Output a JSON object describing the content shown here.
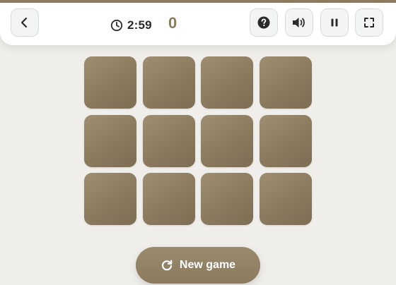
{
  "header": {
    "back_icon": "chevron-left-icon",
    "timer": {
      "icon": "clock-icon",
      "text": "2:59"
    },
    "score": "0",
    "buttons": [
      {
        "name": "help-button",
        "icon": "question-icon"
      },
      {
        "name": "sound-button",
        "icon": "speaker-icon"
      },
      {
        "name": "pause-button",
        "icon": "pause-icon"
      },
      {
        "name": "fullscreen-button",
        "icon": "fullscreen-icon"
      }
    ]
  },
  "board": {
    "rows": 3,
    "columns": 4,
    "face_down_cards": 12,
    "card_color": "#8b7a5e"
  },
  "new_game": {
    "icon": "refresh-icon",
    "label": "New game"
  },
  "colors": {
    "accent": "#8b7a5e",
    "background": "#f0eeea",
    "text": "#2a2a2a"
  }
}
